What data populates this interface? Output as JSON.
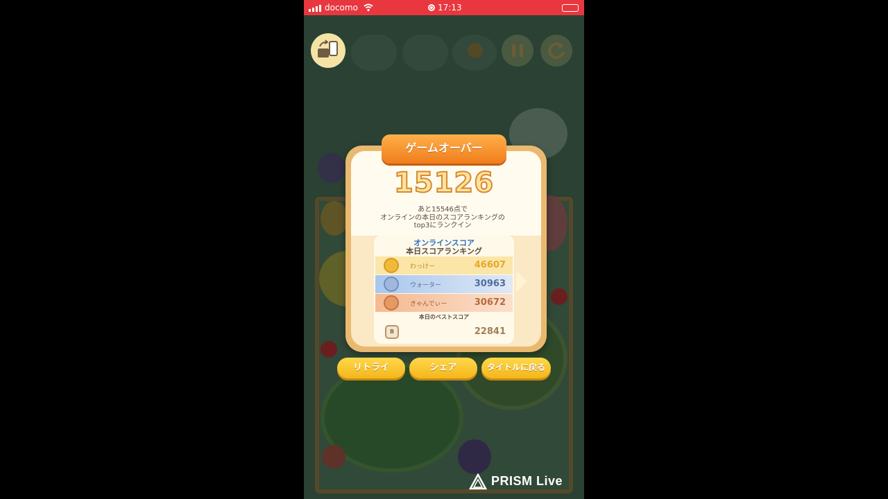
{
  "status_bar": {
    "carrier": "docomo",
    "time": "17:13"
  },
  "dialog": {
    "title": "ゲームオーバー",
    "score": "15126",
    "message_line1": "あと15546点で",
    "message_line2": "オンラインの本日のスコアランキングの",
    "message_line3": "top3にランクイン",
    "ranking": {
      "heading1": "オンラインスコア",
      "heading2": "本日スコアランキング",
      "rows": [
        {
          "rank": "1",
          "name": "わっけー",
          "score": "46607"
        },
        {
          "rank": "2",
          "name": "ウォーター",
          "score": "30963"
        },
        {
          "rank": "3",
          "name": "きゃんでぃー",
          "score": "30672"
        }
      ],
      "best_label": "本日のベストスコア",
      "best_rank_badge": "B",
      "best_score": "22841"
    }
  },
  "buttons": {
    "retry": "リトライ",
    "share": "シェア",
    "back_to_title": "タイトルに戻る"
  },
  "watermark": "PRISM Live",
  "colors": {
    "status_bar": "#e8373f",
    "banner": "#f07d1c",
    "button": "#f4b61c",
    "ranking_heading": "#2d6fc4"
  }
}
